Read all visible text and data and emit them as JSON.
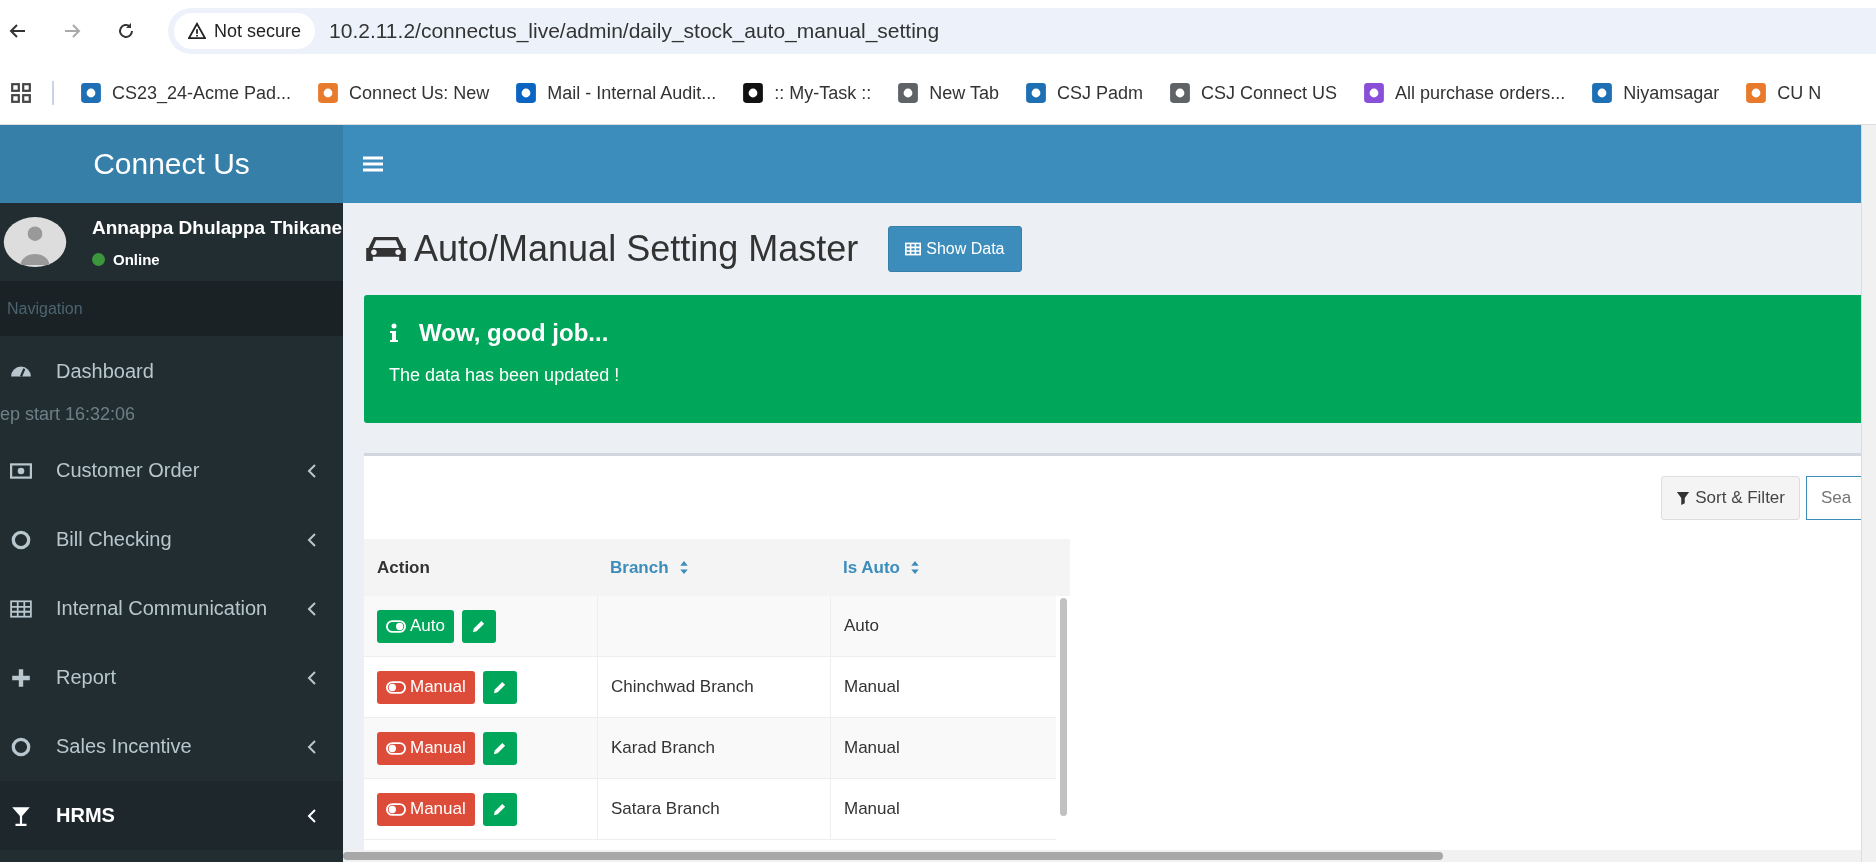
{
  "browser": {
    "security": "Not secure",
    "url": "10.2.11.2/connectus_live/admin/daily_stock_auto_manual_setting",
    "bookmarks": [
      "CS23_24-Acme Pad...",
      "Connect Us: New",
      "Mail - Internal Audit...",
      ":: My-Task ::",
      "New Tab",
      "CSJ Padm",
      "CSJ Connect US",
      "All purchase orders...",
      "Niyamsagar",
      "CU N"
    ]
  },
  "sidebar": {
    "logo": "Connect Us",
    "user": {
      "name": "Annappa Dhulappa Thikane",
      "status": "Online"
    },
    "nav_header": "Navigation",
    "items": [
      {
        "label": "Dashboard",
        "has_caret": false,
        "selected": false
      },
      {
        "label": "Customer Order",
        "has_caret": true,
        "selected": false
      },
      {
        "label": "Bill Checking",
        "has_caret": true,
        "selected": false
      },
      {
        "label": "Internal Communication",
        "has_caret": true,
        "selected": false
      },
      {
        "label": "Report",
        "has_caret": true,
        "selected": false
      },
      {
        "label": "Sales Incentive",
        "has_caret": true,
        "selected": false
      },
      {
        "label": "HRMS",
        "has_caret": true,
        "selected": true
      }
    ],
    "overlay_text": "ep start 16:32:06"
  },
  "page": {
    "title": "Auto/Manual Setting Master",
    "show_data_button": "Show Data"
  },
  "alert": {
    "title": "Wow, good job...",
    "message": "The data has been updated !"
  },
  "toolbar": {
    "sort_filter_button": "Sort & Filter",
    "search": {
      "placeholder": "Sea"
    }
  },
  "table": {
    "columns": [
      {
        "label": "Action",
        "sortable": false
      },
      {
        "label": "Branch",
        "sortable": true
      },
      {
        "label": "Is Auto",
        "sortable": true
      }
    ],
    "rows": [
      {
        "toggle": "Auto",
        "on": true,
        "branch": "",
        "is_auto": "Auto"
      },
      {
        "toggle": "Manual",
        "on": false,
        "branch": "Chinchwad Branch",
        "is_auto": "Manual"
      },
      {
        "toggle": "Manual",
        "on": false,
        "branch": "Karad Branch",
        "is_auto": "Manual"
      },
      {
        "toggle": "Manual",
        "on": false,
        "branch": "Satara Branch",
        "is_auto": "Manual"
      }
    ]
  }
}
